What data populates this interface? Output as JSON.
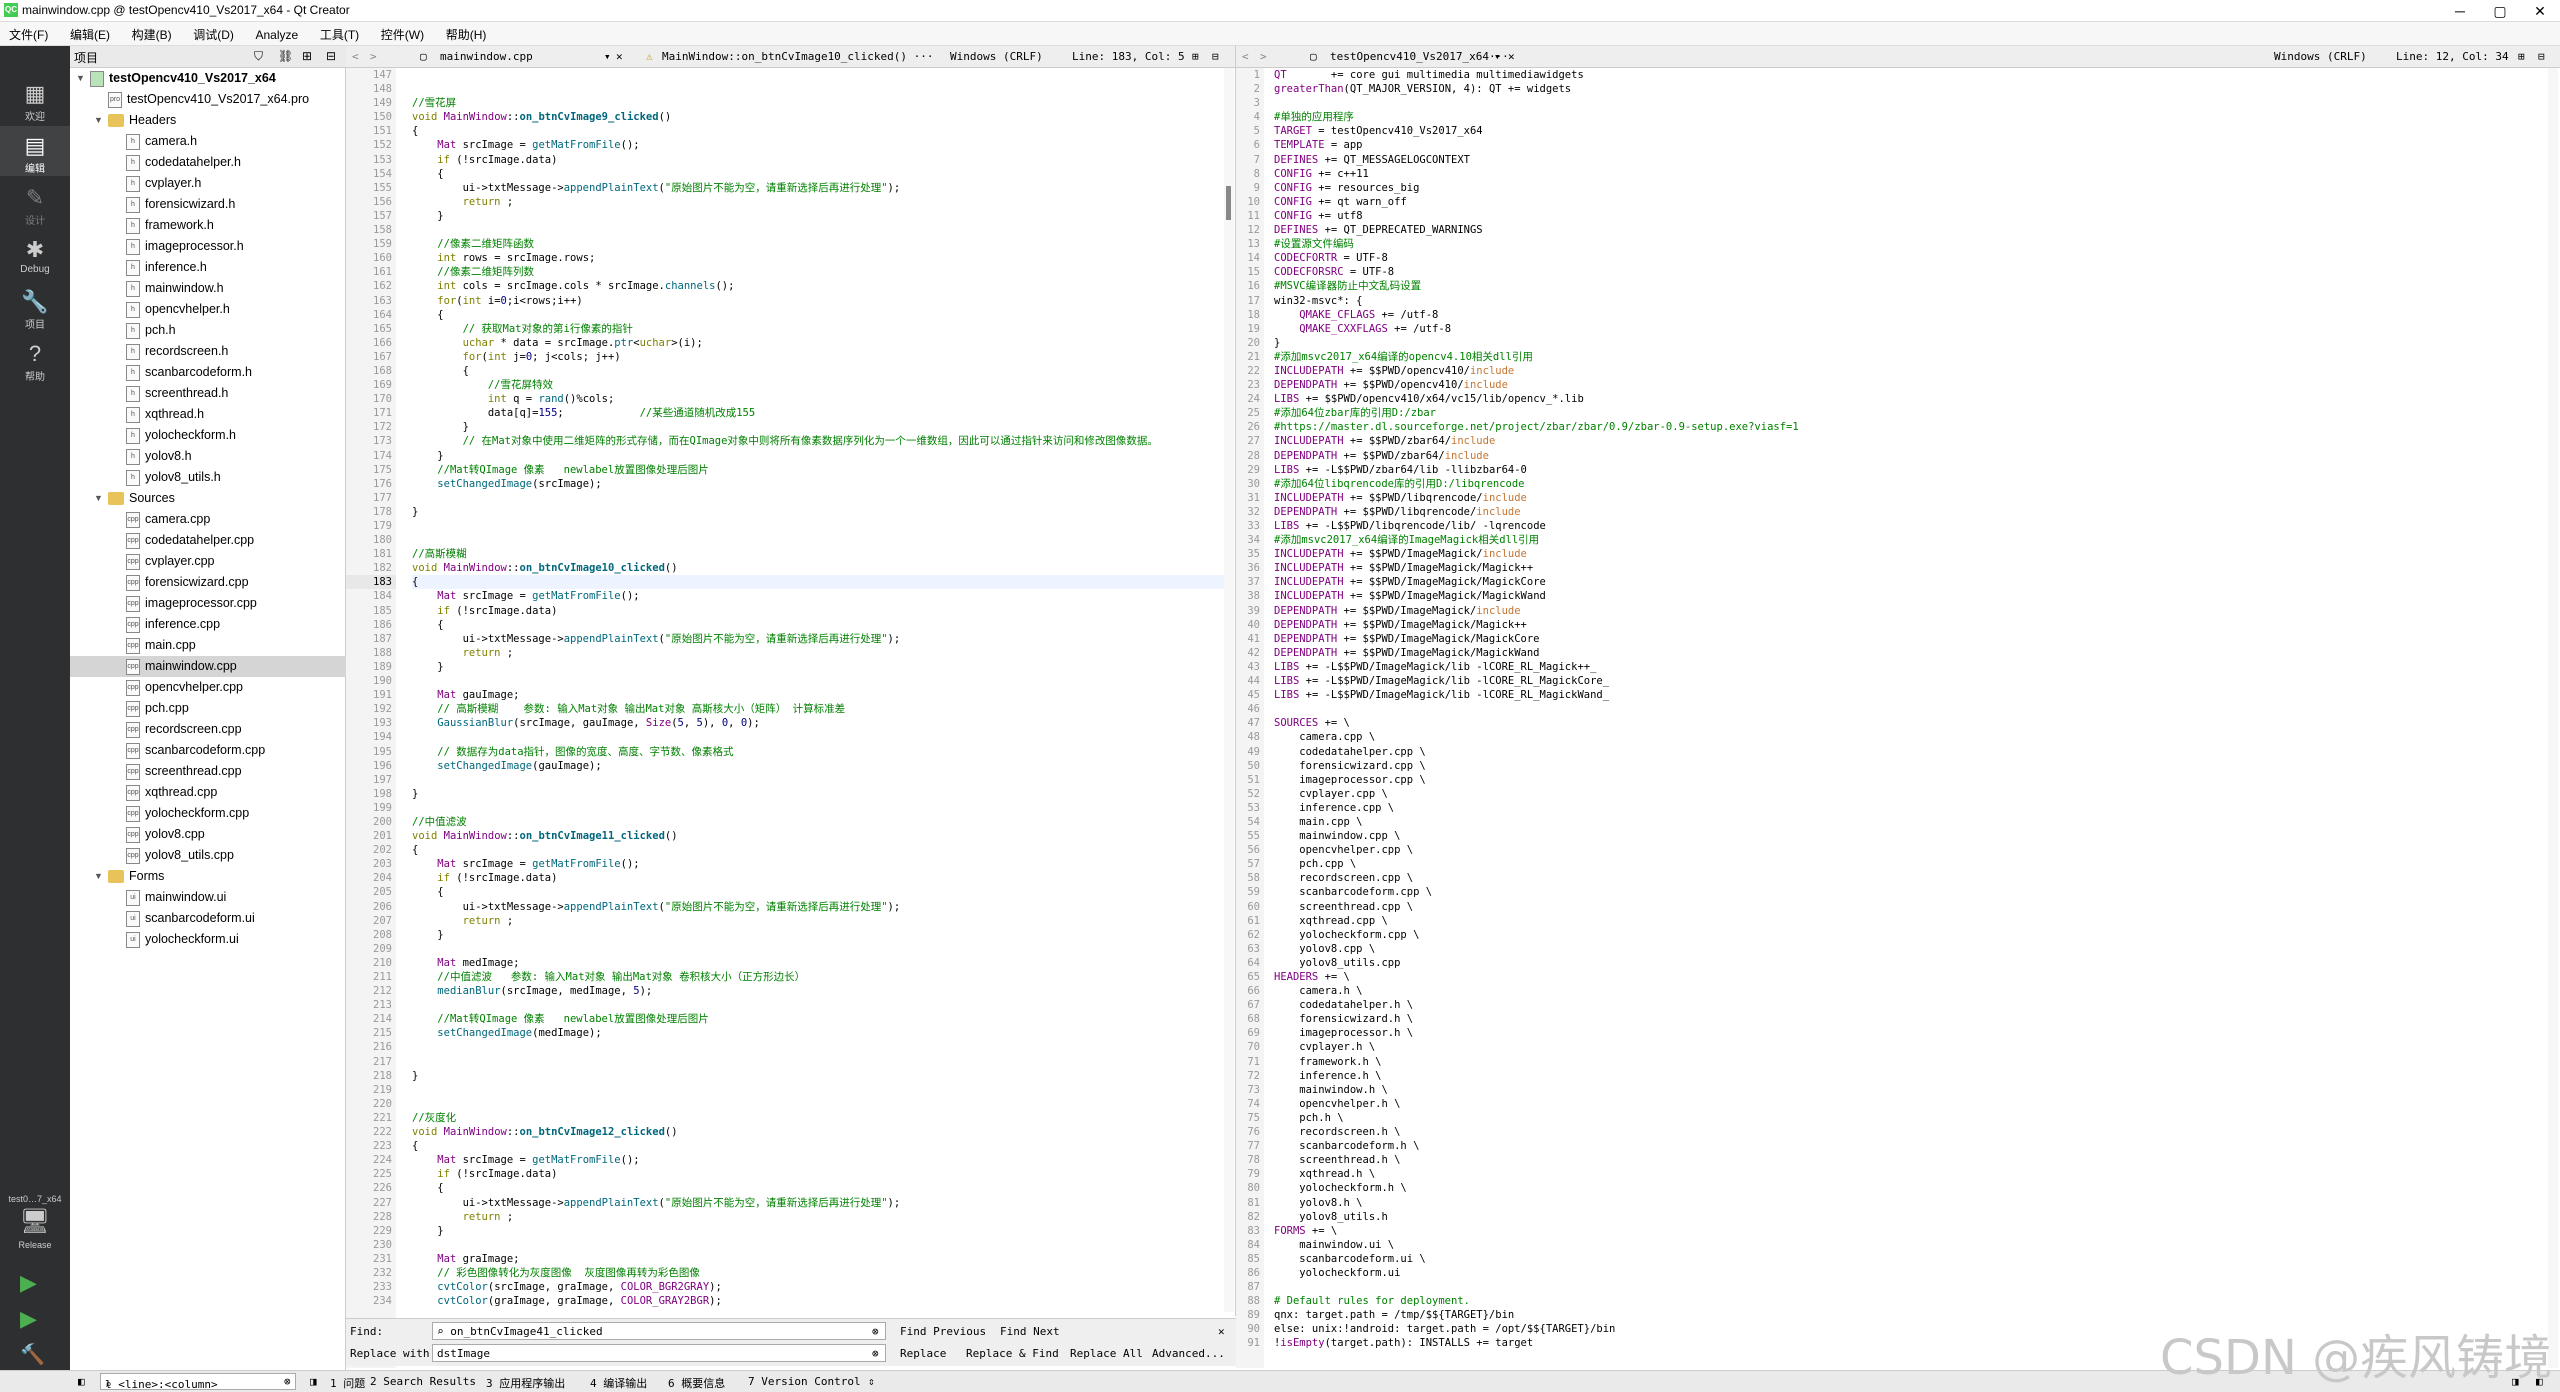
{
  "window": {
    "title": "mainwindow.cpp @ testOpencv410_Vs2017_x64 - Qt Creator",
    "controls": [
      "─",
      "▢",
      "✕"
    ]
  },
  "menu": [
    "文件(F)",
    "编辑(E)",
    "构建(B)",
    "调试(D)",
    "Analyze",
    "工具(T)",
    "控件(W)",
    "帮助(H)"
  ],
  "modes": [
    {
      "label": "欢迎",
      "icon": "grid-icon"
    },
    {
      "label": "编辑",
      "icon": "edit-icon"
    },
    {
      "label": "设计",
      "icon": "pen-icon"
    },
    {
      "label": "Debug",
      "icon": "bug-icon"
    },
    {
      "label": "项目",
      "icon": "wrench-icon"
    },
    {
      "label": "帮助",
      "icon": "help-icon"
    }
  ],
  "kit": {
    "name": "test0…7_x64",
    "config": "Release"
  },
  "project": {
    "header": "项目",
    "rows": [
      {
        "d": 0,
        "type": "proj",
        "label": "testOpencv410_Vs2017_x64",
        "exp": true
      },
      {
        "d": 1,
        "type": "file",
        "label": "testOpencv410_Vs2017_x64.pro"
      },
      {
        "d": 1,
        "type": "folder",
        "label": "Headers",
        "exp": true
      },
      {
        "d": 2,
        "type": "file",
        "label": "camera.h"
      },
      {
        "d": 2,
        "type": "file",
        "label": "codedatahelper.h"
      },
      {
        "d": 2,
        "type": "file",
        "label": "cvplayer.h"
      },
      {
        "d": 2,
        "type": "file",
        "label": "forensicwizard.h"
      },
      {
        "d": 2,
        "type": "file",
        "label": "framework.h"
      },
      {
        "d": 2,
        "type": "file",
        "label": "imageprocessor.h"
      },
      {
        "d": 2,
        "type": "file",
        "label": "inference.h"
      },
      {
        "d": 2,
        "type": "file",
        "label": "mainwindow.h"
      },
      {
        "d": 2,
        "type": "file",
        "label": "opencvhelper.h"
      },
      {
        "d": 2,
        "type": "file",
        "label": "pch.h"
      },
      {
        "d": 2,
        "type": "file",
        "label": "recordscreen.h"
      },
      {
        "d": 2,
        "type": "file",
        "label": "scanbarcodeform.h"
      },
      {
        "d": 2,
        "type": "file",
        "label": "screenthread.h"
      },
      {
        "d": 2,
        "type": "file",
        "label": "xqthread.h"
      },
      {
        "d": 2,
        "type": "file",
        "label": "yolocheckform.h"
      },
      {
        "d": 2,
        "type": "file",
        "label": "yolov8.h"
      },
      {
        "d": 2,
        "type": "file",
        "label": "yolov8_utils.h"
      },
      {
        "d": 1,
        "type": "folder",
        "label": "Sources",
        "exp": true
      },
      {
        "d": 2,
        "type": "file",
        "label": "camera.cpp"
      },
      {
        "d": 2,
        "type": "file",
        "label": "codedatahelper.cpp"
      },
      {
        "d": 2,
        "type": "file",
        "label": "cvplayer.cpp"
      },
      {
        "d": 2,
        "type": "file",
        "label": "forensicwizard.cpp"
      },
      {
        "d": 2,
        "type": "file",
        "label": "imageprocessor.cpp"
      },
      {
        "d": 2,
        "type": "file",
        "label": "inference.cpp"
      },
      {
        "d": 2,
        "type": "file",
        "label": "main.cpp"
      },
      {
        "d": 2,
        "type": "file",
        "label": "mainwindow.cpp",
        "sel": true
      },
      {
        "d": 2,
        "type": "file",
        "label": "opencvhelper.cpp"
      },
      {
        "d": 2,
        "type": "file",
        "label": "pch.cpp"
      },
      {
        "d": 2,
        "type": "file",
        "label": "recordscreen.cpp"
      },
      {
        "d": 2,
        "type": "file",
        "label": "scanbarcodeform.cpp"
      },
      {
        "d": 2,
        "type": "file",
        "label": "screenthread.cpp"
      },
      {
        "d": 2,
        "type": "file",
        "label": "xqthread.cpp"
      },
      {
        "d": 2,
        "type": "file",
        "label": "yolocheckform.cpp"
      },
      {
        "d": 2,
        "type": "file",
        "label": "yolov8.cpp"
      },
      {
        "d": 2,
        "type": "file",
        "label": "yolov8_utils.cpp"
      },
      {
        "d": 1,
        "type": "folder",
        "label": "Forms",
        "exp": true
      },
      {
        "d": 2,
        "type": "file",
        "label": "mainwindow.ui"
      },
      {
        "d": 2,
        "type": "file",
        "label": "scanbarcodeform.ui"
      },
      {
        "d": 2,
        "type": "file",
        "label": "yolocheckform.ui"
      }
    ]
  },
  "left_editor": {
    "file": "mainwindow.cpp",
    "symbol": "MainWindow::on_btnCvImage10_clicked() ···",
    "encoding": "Windows (CRLF)",
    "position": "Line: 183, Col: 5",
    "first_line": 147,
    "current_line": 183,
    "lines": [
      "",
      "",
      "//雪花屏",
      "void MainWindow::on_btnCvImage9_clicked()",
      "{",
      "    Mat srcImage = getMatFromFile();",
      "    if (!srcImage.data)",
      "    {",
      "        ui->txtMessage->appendPlainText(\"原始图片不能为空，请重新选择后再进行处理\");",
      "        return ;",
      "    }",
      "",
      "    //像素二维矩阵函数",
      "    int rows = srcImage.rows;",
      "    //像素二维矩阵列数",
      "    int cols = srcImage.cols * srcImage.channels();",
      "    for(int i=0;i<rows;i++)",
      "    {",
      "        // 获取Mat对象的第i行像素的指针",
      "        uchar * data = srcImage.ptr<uchar>(i);",
      "        for(int j=0; j<cols; j++)",
      "        {",
      "            //雪花屏特效",
      "            int q = rand()%cols;",
      "            data[q]=155;            //某些通道随机改成155",
      "        }",
      "        // 在Mat对象中使用二维矩阵的形式存储，而在QImage对象中则将所有像素数据序列化为一个一维数组，因此可以通过指针来访问和修改图像数据。",
      "    }",
      "    //Mat转QImage 像素   newlabel放置图像处理后图片",
      "    setChangedImage(srcImage);",
      "",
      "}",
      "",
      "",
      "//高斯模糊",
      "void MainWindow::on_btnCvImage10_clicked()",
      "{",
      "    Mat srcImage = getMatFromFile();",
      "    if (!srcImage.data)",
      "    {",
      "        ui->txtMessage->appendPlainText(\"原始图片不能为空，请重新选择后再进行处理\");",
      "        return ;",
      "    }",
      "",
      "    Mat gauImage;",
      "    // 高斯模糊    参数: 输入Mat对象 输出Mat对象 高斯核大小（矩阵） 计算标准差",
      "    GaussianBlur(srcImage, gauImage, Size(5, 5), 0, 0);",
      "",
      "    // 数据存为data指针，图像的宽度、高度、字节数、像素格式",
      "    setChangedImage(gauImage);",
      "",
      "}",
      "",
      "//中值滤波",
      "void MainWindow::on_btnCvImage11_clicked()",
      "{",
      "    Mat srcImage = getMatFromFile();",
      "    if (!srcImage.data)",
      "    {",
      "        ui->txtMessage->appendPlainText(\"原始图片不能为空，请重新选择后再进行处理\");",
      "        return ;",
      "    }",
      "",
      "    Mat medImage;",
      "    //中值滤波   参数: 输入Mat对象 输出Mat对象 卷积核大小（正方形边长）",
      "    medianBlur(srcImage, medImage, 5);",
      "",
      "    //Mat转QImage 像素   newlabel放置图像处理后图片",
      "    setChangedImage(medImage);",
      "",
      "",
      "}",
      "",
      "",
      "//灰度化",
      "void MainWindow::on_btnCvImage12_clicked()",
      "{",
      "    Mat srcImage = getMatFromFile();",
      "    if (!srcImage.data)",
      "    {",
      "        ui->txtMessage->appendPlainText(\"原始图片不能为空，请重新选择后再进行处理\");",
      "        return ;",
      "    }",
      "",
      "    Mat graImage;",
      "    // 彩色图像转化为灰度图像  灰度图像再转为彩色图像",
      "    cvtColor(srcImage, graImage, COLOR_BGR2GRAY);",
      "    cvtColor(graImage, graImage, COLOR_GRAY2BGR);"
    ]
  },
  "right_editor": {
    "file": "testOpencv410_Vs2017_x64···",
    "encoding": "Windows (CRLF)",
    "position": "Line: 12, Col: 34",
    "first_line": 1,
    "lines": [
      "QT       += core gui multimedia multimediawidgets",
      "greaterThan(QT_MAJOR_VERSION, 4): QT += widgets",
      "",
      "#单独的应用程序",
      "TARGET = testOpencv410_Vs2017_x64",
      "TEMPLATE = app",
      "DEFINES += QT_MESSAGELOGCONTEXT",
      "CONFIG += c++11",
      "CONFIG += resources_big",
      "CONFIG += qt warn_off",
      "CONFIG += utf8",
      "DEFINES += QT_DEPRECATED_WARNINGS",
      "#设置源文件编码",
      "CODECFORTR = UTF-8",
      "CODECFORSRC = UTF-8",
      "#MSVC编译器防止中文乱码设置",
      "win32-msvc*: {",
      "    QMAKE_CFLAGS += /utf-8",
      "    QMAKE_CXXFLAGS += /utf-8",
      "}",
      "#添加msvc2017_x64编译的opencv4.10相关dll引用",
      "INCLUDEPATH += $$PWD/opencv410/include",
      "DEPENDPATH += $$PWD/opencv410/include",
      "LIBS += $$PWD/opencv410/x64/vc15/lib/opencv_*.lib",
      "#添加64位zbar库的引用D:/zbar",
      "#https://master.dl.sourceforge.net/project/zbar/zbar/0.9/zbar-0.9-setup.exe?viasf=1",
      "INCLUDEPATH += $$PWD/zbar64/include",
      "DEPENDPATH += $$PWD/zbar64/include",
      "LIBS += -L$$PWD/zbar64/lib -llibzbar64-0",
      "#添加64位libqrencode库的引用D:/libqrencode",
      "INCLUDEPATH += $$PWD/libqrencode/include",
      "DEPENDPATH += $$PWD/libqrencode/include",
      "LIBS += -L$$PWD/libqrencode/lib/ -lqrencode",
      "#添加msvc2017_x64编译的ImageMagick相关dll引用",
      "INCLUDEPATH += $$PWD/ImageMagick/include",
      "INCLUDEPATH += $$PWD/ImageMagick/Magick++",
      "INCLUDEPATH += $$PWD/ImageMagick/MagickCore",
      "INCLUDEPATH += $$PWD/ImageMagick/MagickWand",
      "DEPENDPATH += $$PWD/ImageMagick/include",
      "DEPENDPATH += $$PWD/ImageMagick/Magick++",
      "DEPENDPATH += $$PWD/ImageMagick/MagickCore",
      "DEPENDPATH += $$PWD/ImageMagick/MagickWand",
      "LIBS += -L$$PWD/ImageMagick/lib -lCORE_RL_Magick++_",
      "LIBS += -L$$PWD/ImageMagick/lib -lCORE_RL_MagickCore_",
      "LIBS += -L$$PWD/ImageMagick/lib -lCORE_RL_MagickWand_",
      "",
      "SOURCES += \\",
      "    camera.cpp \\",
      "    codedatahelper.cpp \\",
      "    forensicwizard.cpp \\",
      "    imageprocessor.cpp \\",
      "    cvplayer.cpp \\",
      "    inference.cpp \\",
      "    main.cpp \\",
      "    mainwindow.cpp \\",
      "    opencvhelper.cpp \\",
      "    pch.cpp \\",
      "    recordscreen.cpp \\",
      "    scanbarcodeform.cpp \\",
      "    screenthread.cpp \\",
      "    xqthread.cpp \\",
      "    yolocheckform.cpp \\",
      "    yolov8.cpp \\",
      "    yolov8_utils.cpp",
      "HEADERS += \\",
      "    camera.h \\",
      "    codedatahelper.h \\",
      "    forensicwizard.h \\",
      "    imageprocessor.h \\",
      "    cvplayer.h \\",
      "    framework.h \\",
      "    inference.h \\",
      "    mainwindow.h \\",
      "    opencvhelper.h \\",
      "    pch.h \\",
      "    recordscreen.h \\",
      "    scanbarcodeform.h \\",
      "    screenthread.h \\",
      "    xqthread.h \\",
      "    yolocheckform.h \\",
      "    yolov8.h \\",
      "    yolov8_utils.h",
      "FORMS += \\",
      "    mainwindow.ui \\",
      "    scanbarcodeform.ui \\",
      "    yolocheckform.ui",
      "",
      "# Default rules for deployment.",
      "qnx: target.path = /tmp/$${TARGET}/bin",
      "else: unix:!android: target.path = /opt/$${TARGET}/bin",
      "!isEmpty(target.path): INSTALLS += target"
    ]
  },
  "find": {
    "find_label": "Find:",
    "find_value": "on_btnCvImage41_clicked",
    "replace_label": "Replace with:",
    "replace_value": "dstImage",
    "find_previous": "Find Previous",
    "find_next": "Find Next",
    "replace": "Replace",
    "replace_find": "Replace & Find",
    "replace_all": "Replace All",
    "advanced": "Advanced..."
  },
  "status": {
    "locator_placeholder": "l <line>:<column>",
    "tabs": [
      "1 问题",
      "2 Search Results",
      "3 应用程序输出",
      "4 编译输出",
      "6 概要信息",
      "7 Version Control"
    ]
  },
  "watermark": "CSDN @疾风铸境"
}
